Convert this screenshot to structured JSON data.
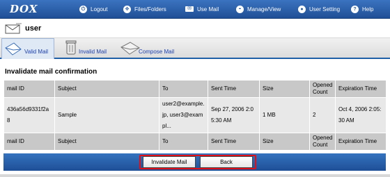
{
  "header": {
    "logo": "DOX",
    "nav": [
      {
        "label": "Logout",
        "icon": "logout-icon"
      },
      {
        "label": "Files/Folders",
        "icon": "files-folders-icon"
      },
      {
        "label": "Use Mail",
        "icon": "mail-icon"
      },
      {
        "label": "Manage/View",
        "icon": "manage-view-icon"
      },
      {
        "label": "User Setting",
        "icon": "user-setting-icon"
      },
      {
        "label": "Help",
        "icon": "help-icon"
      }
    ]
  },
  "user": {
    "name": "user"
  },
  "tabs": [
    {
      "label": "Valid Mail",
      "active": true
    },
    {
      "label": "Invalid Mail",
      "active": false
    },
    {
      "label": "Compose Mail",
      "active": false
    }
  ],
  "page_title": "Invalidate mail confirmation",
  "table": {
    "headers": [
      "mail ID",
      "Subject",
      "To",
      "Sent Time",
      "Size",
      "Opened Count",
      "Expiration Time"
    ],
    "rows": [
      [
        "436a56d9331f2a8",
        "Sample",
        "user2@example.jp, user3@exampl...",
        "Sep 27, 2006 2:05:30 AM",
        "1 MB",
        "2",
        "Oct 4, 2006 2:05:30 AM"
      ]
    ]
  },
  "actions": {
    "invalidate_label": "Invalidate Mail",
    "back_label": "Back"
  },
  "colors": {
    "header_blue": "#2a5fab",
    "highlight_red": "#e0101a"
  }
}
